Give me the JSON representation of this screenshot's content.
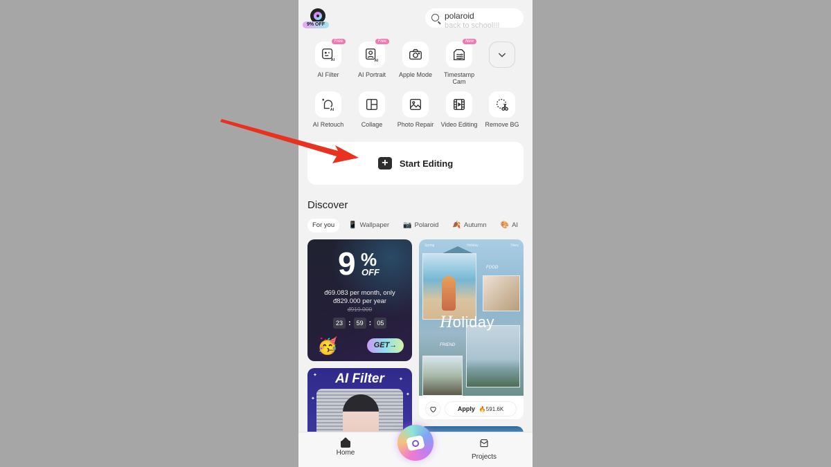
{
  "header": {
    "promo_badge": "9% OFF",
    "search": {
      "value": "polaroid",
      "next_suggestion": "back to school!!!"
    }
  },
  "tools": [
    {
      "label": "AI Filter",
      "icon": "ai-face-icon",
      "tag": "Free"
    },
    {
      "label": "AI Portrait",
      "icon": "portrait-icon",
      "tag": "Free"
    },
    {
      "label": "Apple Mode",
      "icon": "camera-icon",
      "tag": ""
    },
    {
      "label": "Timestamp Cam",
      "icon": "timestamp-icon",
      "tag": "New"
    },
    {
      "label": "",
      "icon": "chevron-down-icon",
      "tag": ""
    },
    {
      "label": "AI Retouch",
      "icon": "retouch-icon",
      "tag": ""
    },
    {
      "label": "Collage",
      "icon": "collage-icon",
      "tag": ""
    },
    {
      "label": "Photo Repair",
      "icon": "photo-icon",
      "tag": ""
    },
    {
      "label": "Video Editing",
      "icon": "film-icon",
      "tag": ""
    },
    {
      "label": "Remove BG",
      "icon": "scissors-icon",
      "tag": ""
    }
  ],
  "start_editing": {
    "label": "Start Editing",
    "icon": "+"
  },
  "discover": {
    "title": "Discover",
    "chips": [
      {
        "label": "For you",
        "icon": "",
        "active": true
      },
      {
        "label": "Wallpaper",
        "icon": "📱",
        "active": false
      },
      {
        "label": "Polaroid",
        "icon": "📷",
        "active": false
      },
      {
        "label": "Autumn",
        "icon": "🍂",
        "active": false
      },
      {
        "label": "AI",
        "icon": "🎨",
        "active": false
      }
    ],
    "promo_card": {
      "big": "9",
      "percent": "%",
      "off": "OFF",
      "line1": "đ69.083 per month, only",
      "line2": "đ829.000 per year",
      "old_price": "đ919.000",
      "timer": [
        "23",
        "59",
        "05"
      ],
      "emoji": "🥳",
      "cta": "GET→"
    },
    "holiday_card": {
      "top_labels": [
        "Spring",
        "Holiday",
        "Diary"
      ],
      "title_cap": "H",
      "title_rest": "oliday",
      "label_food": "FOOD",
      "label_friend": "FRIEND",
      "apply_label": "Apply",
      "apply_count": "🔥591.6K"
    },
    "ai_filter_card": {
      "title": "AI Filter"
    }
  },
  "bottom_nav": {
    "home": "Home",
    "projects": "Projects"
  },
  "colors": {
    "background": "#f2f2f2",
    "outer": "#a6a6a6",
    "tag_pink": "#f07ab0",
    "arrow_red": "#e8321f"
  }
}
